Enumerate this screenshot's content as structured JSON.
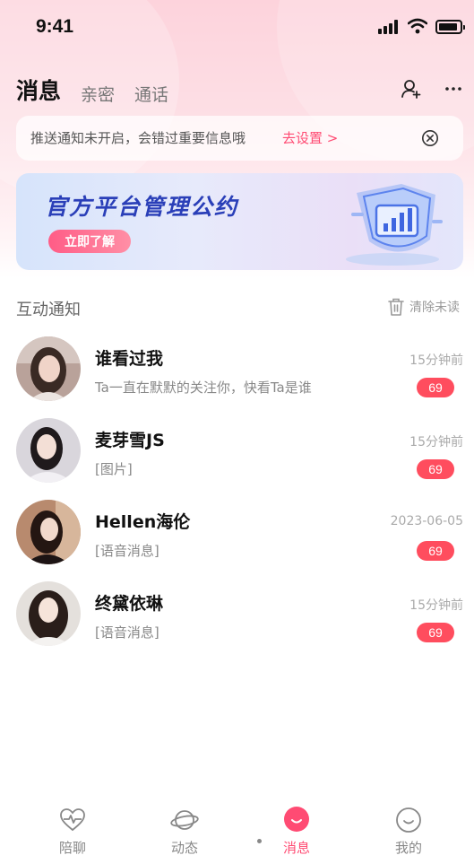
{
  "status_bar": {
    "time": "9:41"
  },
  "header": {
    "tabs": [
      {
        "label": "消息",
        "active": true
      },
      {
        "label": "亲密",
        "active": false
      },
      {
        "label": "通话",
        "active": false
      }
    ],
    "icons": [
      "add-user-icon",
      "more-icon"
    ]
  },
  "notify_bar": {
    "text": "推送通知未开启，会错过重要信息哦",
    "link_label": "去设置 >"
  },
  "banner": {
    "title": "官方平台管理公约",
    "button_label": "立即了解"
  },
  "section": {
    "title": "互动通知",
    "clear_label": "清除未读"
  },
  "conversations": [
    {
      "name": "谁看过我",
      "message": "Ta一直在默默的关注你，快看Ta是谁",
      "time": "15分钟前",
      "badge": "69"
    },
    {
      "name": "麦芽雪JS",
      "message": "[图片]",
      "time": "15分钟前",
      "badge": "69"
    },
    {
      "name": "Hellen海伦",
      "message": "[语音消息]",
      "time": "2023-06-05",
      "badge": "69"
    },
    {
      "name": "终黛依琳",
      "message": "[语音消息]",
      "time": "15分钟前",
      "badge": "69"
    }
  ],
  "bottom_nav": [
    {
      "label": "陪聊",
      "icon": "heartbeat-icon",
      "active": false
    },
    {
      "label": "动态",
      "icon": "planet-icon",
      "active": false
    },
    {
      "label": "消息",
      "icon": "message-icon",
      "active": true
    },
    {
      "label": "我的",
      "icon": "smile-icon",
      "active": false
    }
  ],
  "colors": {
    "accent": "#ff4b73",
    "badge": "#ff4d5e",
    "banner_title": "#2a3fb8"
  }
}
